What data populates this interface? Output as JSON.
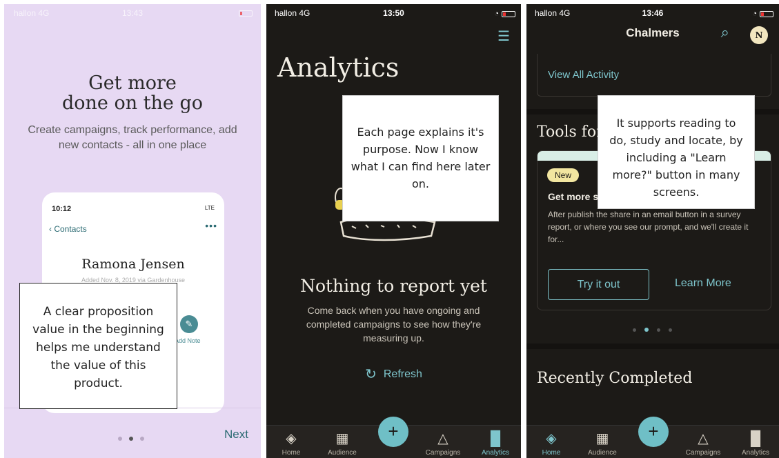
{
  "phone1": {
    "status": {
      "carrier": "hallon 4G",
      "time": "13:43"
    },
    "headline_line1": "Get more",
    "headline_line2": "done on the go",
    "subtitle": "Create campaigns, track performance, add new contacts - all in one place",
    "mockup": {
      "time": "10:12",
      "signal": "LTE",
      "back_label": "Contacts",
      "more": "•••",
      "contact_name": "Ramona Jensen",
      "added_text": "Added Nov. 8, 2019 via Gardenhouse",
      "note_label": "Add Note"
    },
    "next_label": "Next",
    "page_count": 3,
    "active_page": 2
  },
  "phone2": {
    "status": {
      "carrier": "hallon 4G",
      "time": "13:50"
    },
    "title": "Analytics",
    "empty_title": "Nothing to report yet",
    "empty_subtitle": "Come back when you have ongoing and completed campaigns to see how they're measuring up.",
    "refresh_label": "Refresh",
    "tabs": [
      {
        "label": "Home",
        "icon": "home-icon",
        "active": false
      },
      {
        "label": "Audience",
        "icon": "audience-icon",
        "active": false
      },
      {
        "label": "Campaigns",
        "icon": "campaigns-icon",
        "active": false
      },
      {
        "label": "Analytics",
        "icon": "analytics-icon",
        "active": true
      }
    ],
    "fab_label": "+"
  },
  "phone3": {
    "status": {
      "carrier": "hallon 4G",
      "time": "13:46"
    },
    "title": "Chalmers",
    "avatar_initial": "N",
    "view_all_label": "View All Activity",
    "tools_title": "Tools for",
    "card": {
      "badge": "New",
      "heading": "Get more s",
      "text": "After publish the share in an email button in a survey report, or where you see our prompt, and we'll create it for...",
      "try_label": "Try it out",
      "learn_label": "Learn More"
    },
    "recent_title": "Recently Completed",
    "tabs": [
      {
        "label": "Home",
        "icon": "home-icon",
        "active": true
      },
      {
        "label": "Audience",
        "icon": "audience-icon",
        "active": false
      },
      {
        "label": "Campaigns",
        "icon": "campaigns-icon",
        "active": false
      },
      {
        "label": "Analytics",
        "icon": "analytics-icon",
        "active": false
      }
    ],
    "fab_label": "+",
    "page_count": 4,
    "active_page": 2
  },
  "callouts": {
    "c1": "A clear proposition value in the beginning helps me understand the value of this product.",
    "c2": "Each page explains it's purpose. Now I know what I can find here later on.",
    "c3": "It supports reading to do, study and locate, by including a \"Learn more?\" button in many screens."
  },
  "colors": {
    "onboarding_bg": "#e7d9f3",
    "dark_bg": "#1c1a17",
    "accent": "#7ec5cc",
    "badge": "#f2e6a0"
  }
}
